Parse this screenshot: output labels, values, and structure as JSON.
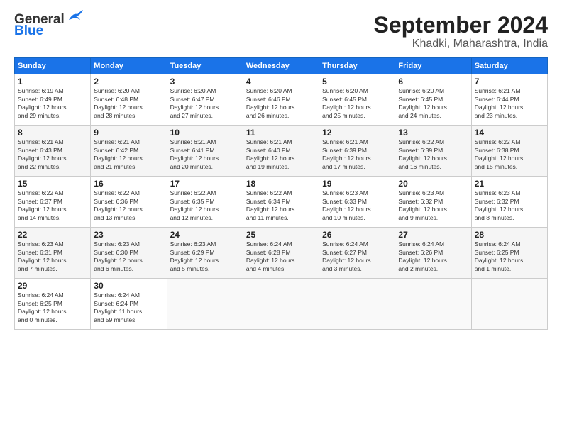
{
  "logo": {
    "line1": "General",
    "line2": "Blue"
  },
  "title": "September 2024",
  "location": "Khadki, Maharashtra, India",
  "days_of_week": [
    "Sunday",
    "Monday",
    "Tuesday",
    "Wednesday",
    "Thursday",
    "Friday",
    "Saturday"
  ],
  "weeks": [
    [
      {
        "day": 1,
        "info": "Sunrise: 6:19 AM\nSunset: 6:49 PM\nDaylight: 12 hours\nand 29 minutes."
      },
      {
        "day": 2,
        "info": "Sunrise: 6:20 AM\nSunset: 6:48 PM\nDaylight: 12 hours\nand 28 minutes."
      },
      {
        "day": 3,
        "info": "Sunrise: 6:20 AM\nSunset: 6:47 PM\nDaylight: 12 hours\nand 27 minutes."
      },
      {
        "day": 4,
        "info": "Sunrise: 6:20 AM\nSunset: 6:46 PM\nDaylight: 12 hours\nand 26 minutes."
      },
      {
        "day": 5,
        "info": "Sunrise: 6:20 AM\nSunset: 6:45 PM\nDaylight: 12 hours\nand 25 minutes."
      },
      {
        "day": 6,
        "info": "Sunrise: 6:20 AM\nSunset: 6:45 PM\nDaylight: 12 hours\nand 24 minutes."
      },
      {
        "day": 7,
        "info": "Sunrise: 6:21 AM\nSunset: 6:44 PM\nDaylight: 12 hours\nand 23 minutes."
      }
    ],
    [
      {
        "day": 8,
        "info": "Sunrise: 6:21 AM\nSunset: 6:43 PM\nDaylight: 12 hours\nand 22 minutes."
      },
      {
        "day": 9,
        "info": "Sunrise: 6:21 AM\nSunset: 6:42 PM\nDaylight: 12 hours\nand 21 minutes."
      },
      {
        "day": 10,
        "info": "Sunrise: 6:21 AM\nSunset: 6:41 PM\nDaylight: 12 hours\nand 20 minutes."
      },
      {
        "day": 11,
        "info": "Sunrise: 6:21 AM\nSunset: 6:40 PM\nDaylight: 12 hours\nand 19 minutes."
      },
      {
        "day": 12,
        "info": "Sunrise: 6:21 AM\nSunset: 6:39 PM\nDaylight: 12 hours\nand 17 minutes."
      },
      {
        "day": 13,
        "info": "Sunrise: 6:22 AM\nSunset: 6:39 PM\nDaylight: 12 hours\nand 16 minutes."
      },
      {
        "day": 14,
        "info": "Sunrise: 6:22 AM\nSunset: 6:38 PM\nDaylight: 12 hours\nand 15 minutes."
      }
    ],
    [
      {
        "day": 15,
        "info": "Sunrise: 6:22 AM\nSunset: 6:37 PM\nDaylight: 12 hours\nand 14 minutes."
      },
      {
        "day": 16,
        "info": "Sunrise: 6:22 AM\nSunset: 6:36 PM\nDaylight: 12 hours\nand 13 minutes."
      },
      {
        "day": 17,
        "info": "Sunrise: 6:22 AM\nSunset: 6:35 PM\nDaylight: 12 hours\nand 12 minutes."
      },
      {
        "day": 18,
        "info": "Sunrise: 6:22 AM\nSunset: 6:34 PM\nDaylight: 12 hours\nand 11 minutes."
      },
      {
        "day": 19,
        "info": "Sunrise: 6:23 AM\nSunset: 6:33 PM\nDaylight: 12 hours\nand 10 minutes."
      },
      {
        "day": 20,
        "info": "Sunrise: 6:23 AM\nSunset: 6:32 PM\nDaylight: 12 hours\nand 9 minutes."
      },
      {
        "day": 21,
        "info": "Sunrise: 6:23 AM\nSunset: 6:32 PM\nDaylight: 12 hours\nand 8 minutes."
      }
    ],
    [
      {
        "day": 22,
        "info": "Sunrise: 6:23 AM\nSunset: 6:31 PM\nDaylight: 12 hours\nand 7 minutes."
      },
      {
        "day": 23,
        "info": "Sunrise: 6:23 AM\nSunset: 6:30 PM\nDaylight: 12 hours\nand 6 minutes."
      },
      {
        "day": 24,
        "info": "Sunrise: 6:23 AM\nSunset: 6:29 PM\nDaylight: 12 hours\nand 5 minutes."
      },
      {
        "day": 25,
        "info": "Sunrise: 6:24 AM\nSunset: 6:28 PM\nDaylight: 12 hours\nand 4 minutes."
      },
      {
        "day": 26,
        "info": "Sunrise: 6:24 AM\nSunset: 6:27 PM\nDaylight: 12 hours\nand 3 minutes."
      },
      {
        "day": 27,
        "info": "Sunrise: 6:24 AM\nSunset: 6:26 PM\nDaylight: 12 hours\nand 2 minutes."
      },
      {
        "day": 28,
        "info": "Sunrise: 6:24 AM\nSunset: 6:25 PM\nDaylight: 12 hours\nand 1 minute."
      }
    ],
    [
      {
        "day": 29,
        "info": "Sunrise: 6:24 AM\nSunset: 6:25 PM\nDaylight: 12 hours\nand 0 minutes."
      },
      {
        "day": 30,
        "info": "Sunrise: 6:24 AM\nSunset: 6:24 PM\nDaylight: 11 hours\nand 59 minutes."
      },
      null,
      null,
      null,
      null,
      null
    ]
  ]
}
